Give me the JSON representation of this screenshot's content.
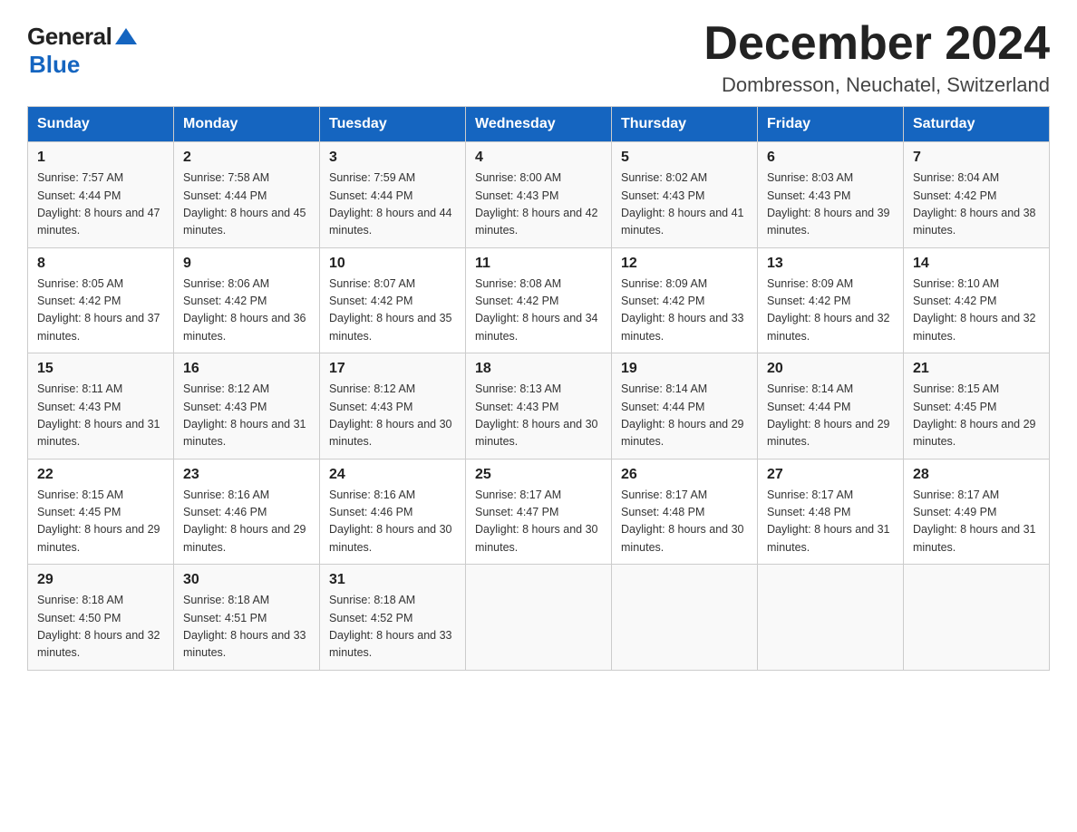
{
  "header": {
    "logo_general": "General",
    "logo_blue": "Blue",
    "title": "December 2024",
    "location": "Dombresson, Neuchatel, Switzerland"
  },
  "days_of_week": [
    "Sunday",
    "Monday",
    "Tuesday",
    "Wednesday",
    "Thursday",
    "Friday",
    "Saturday"
  ],
  "weeks": [
    [
      {
        "day": "1",
        "sunrise": "Sunrise: 7:57 AM",
        "sunset": "Sunset: 4:44 PM",
        "daylight": "Daylight: 8 hours and 47 minutes."
      },
      {
        "day": "2",
        "sunrise": "Sunrise: 7:58 AM",
        "sunset": "Sunset: 4:44 PM",
        "daylight": "Daylight: 8 hours and 45 minutes."
      },
      {
        "day": "3",
        "sunrise": "Sunrise: 7:59 AM",
        "sunset": "Sunset: 4:44 PM",
        "daylight": "Daylight: 8 hours and 44 minutes."
      },
      {
        "day": "4",
        "sunrise": "Sunrise: 8:00 AM",
        "sunset": "Sunset: 4:43 PM",
        "daylight": "Daylight: 8 hours and 42 minutes."
      },
      {
        "day": "5",
        "sunrise": "Sunrise: 8:02 AM",
        "sunset": "Sunset: 4:43 PM",
        "daylight": "Daylight: 8 hours and 41 minutes."
      },
      {
        "day": "6",
        "sunrise": "Sunrise: 8:03 AM",
        "sunset": "Sunset: 4:43 PM",
        "daylight": "Daylight: 8 hours and 39 minutes."
      },
      {
        "day": "7",
        "sunrise": "Sunrise: 8:04 AM",
        "sunset": "Sunset: 4:42 PM",
        "daylight": "Daylight: 8 hours and 38 minutes."
      }
    ],
    [
      {
        "day": "8",
        "sunrise": "Sunrise: 8:05 AM",
        "sunset": "Sunset: 4:42 PM",
        "daylight": "Daylight: 8 hours and 37 minutes."
      },
      {
        "day": "9",
        "sunrise": "Sunrise: 8:06 AM",
        "sunset": "Sunset: 4:42 PM",
        "daylight": "Daylight: 8 hours and 36 minutes."
      },
      {
        "day": "10",
        "sunrise": "Sunrise: 8:07 AM",
        "sunset": "Sunset: 4:42 PM",
        "daylight": "Daylight: 8 hours and 35 minutes."
      },
      {
        "day": "11",
        "sunrise": "Sunrise: 8:08 AM",
        "sunset": "Sunset: 4:42 PM",
        "daylight": "Daylight: 8 hours and 34 minutes."
      },
      {
        "day": "12",
        "sunrise": "Sunrise: 8:09 AM",
        "sunset": "Sunset: 4:42 PM",
        "daylight": "Daylight: 8 hours and 33 minutes."
      },
      {
        "day": "13",
        "sunrise": "Sunrise: 8:09 AM",
        "sunset": "Sunset: 4:42 PM",
        "daylight": "Daylight: 8 hours and 32 minutes."
      },
      {
        "day": "14",
        "sunrise": "Sunrise: 8:10 AM",
        "sunset": "Sunset: 4:42 PM",
        "daylight": "Daylight: 8 hours and 32 minutes."
      }
    ],
    [
      {
        "day": "15",
        "sunrise": "Sunrise: 8:11 AM",
        "sunset": "Sunset: 4:43 PM",
        "daylight": "Daylight: 8 hours and 31 minutes."
      },
      {
        "day": "16",
        "sunrise": "Sunrise: 8:12 AM",
        "sunset": "Sunset: 4:43 PM",
        "daylight": "Daylight: 8 hours and 31 minutes."
      },
      {
        "day": "17",
        "sunrise": "Sunrise: 8:12 AM",
        "sunset": "Sunset: 4:43 PM",
        "daylight": "Daylight: 8 hours and 30 minutes."
      },
      {
        "day": "18",
        "sunrise": "Sunrise: 8:13 AM",
        "sunset": "Sunset: 4:43 PM",
        "daylight": "Daylight: 8 hours and 30 minutes."
      },
      {
        "day": "19",
        "sunrise": "Sunrise: 8:14 AM",
        "sunset": "Sunset: 4:44 PM",
        "daylight": "Daylight: 8 hours and 29 minutes."
      },
      {
        "day": "20",
        "sunrise": "Sunrise: 8:14 AM",
        "sunset": "Sunset: 4:44 PM",
        "daylight": "Daylight: 8 hours and 29 minutes."
      },
      {
        "day": "21",
        "sunrise": "Sunrise: 8:15 AM",
        "sunset": "Sunset: 4:45 PM",
        "daylight": "Daylight: 8 hours and 29 minutes."
      }
    ],
    [
      {
        "day": "22",
        "sunrise": "Sunrise: 8:15 AM",
        "sunset": "Sunset: 4:45 PM",
        "daylight": "Daylight: 8 hours and 29 minutes."
      },
      {
        "day": "23",
        "sunrise": "Sunrise: 8:16 AM",
        "sunset": "Sunset: 4:46 PM",
        "daylight": "Daylight: 8 hours and 29 minutes."
      },
      {
        "day": "24",
        "sunrise": "Sunrise: 8:16 AM",
        "sunset": "Sunset: 4:46 PM",
        "daylight": "Daylight: 8 hours and 30 minutes."
      },
      {
        "day": "25",
        "sunrise": "Sunrise: 8:17 AM",
        "sunset": "Sunset: 4:47 PM",
        "daylight": "Daylight: 8 hours and 30 minutes."
      },
      {
        "day": "26",
        "sunrise": "Sunrise: 8:17 AM",
        "sunset": "Sunset: 4:48 PM",
        "daylight": "Daylight: 8 hours and 30 minutes."
      },
      {
        "day": "27",
        "sunrise": "Sunrise: 8:17 AM",
        "sunset": "Sunset: 4:48 PM",
        "daylight": "Daylight: 8 hours and 31 minutes."
      },
      {
        "day": "28",
        "sunrise": "Sunrise: 8:17 AM",
        "sunset": "Sunset: 4:49 PM",
        "daylight": "Daylight: 8 hours and 31 minutes."
      }
    ],
    [
      {
        "day": "29",
        "sunrise": "Sunrise: 8:18 AM",
        "sunset": "Sunset: 4:50 PM",
        "daylight": "Daylight: 8 hours and 32 minutes."
      },
      {
        "day": "30",
        "sunrise": "Sunrise: 8:18 AM",
        "sunset": "Sunset: 4:51 PM",
        "daylight": "Daylight: 8 hours and 33 minutes."
      },
      {
        "day": "31",
        "sunrise": "Sunrise: 8:18 AM",
        "sunset": "Sunset: 4:52 PM",
        "daylight": "Daylight: 8 hours and 33 minutes."
      },
      null,
      null,
      null,
      null
    ]
  ]
}
